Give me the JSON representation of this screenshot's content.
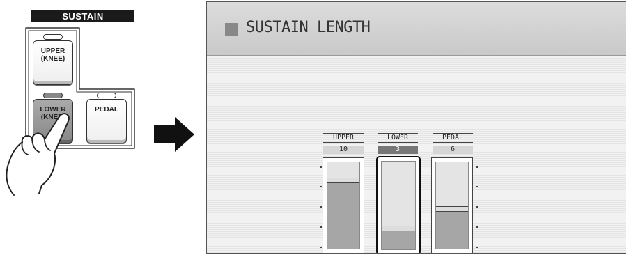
{
  "panel": {
    "header": "SUSTAIN",
    "buttons": {
      "upper": {
        "line1": "UPPER",
        "line2": "(KNEE)"
      },
      "lower": {
        "line1": "LOWER",
        "line2": "(KNEE)"
      },
      "pedal": {
        "line1": "PEDAL",
        "line2": ""
      }
    },
    "pressed_button": "lower"
  },
  "screen": {
    "title": "SUSTAIN LENGTH",
    "channels": [
      {
        "id": "upper",
        "label": "UPPER",
        "value": "10",
        "level": 0.78,
        "selected": false
      },
      {
        "id": "lower",
        "label": "LOWER",
        "value": "3",
        "level": 0.23,
        "selected": true
      },
      {
        "id": "pedal",
        "label": "PEDAL",
        "value": "6",
        "level": 0.45,
        "selected": false
      }
    ]
  },
  "colors": {
    "pressed_button": "#888888",
    "selected_value_bg": "#777777",
    "slider_fill": "#a6a6a6"
  }
}
